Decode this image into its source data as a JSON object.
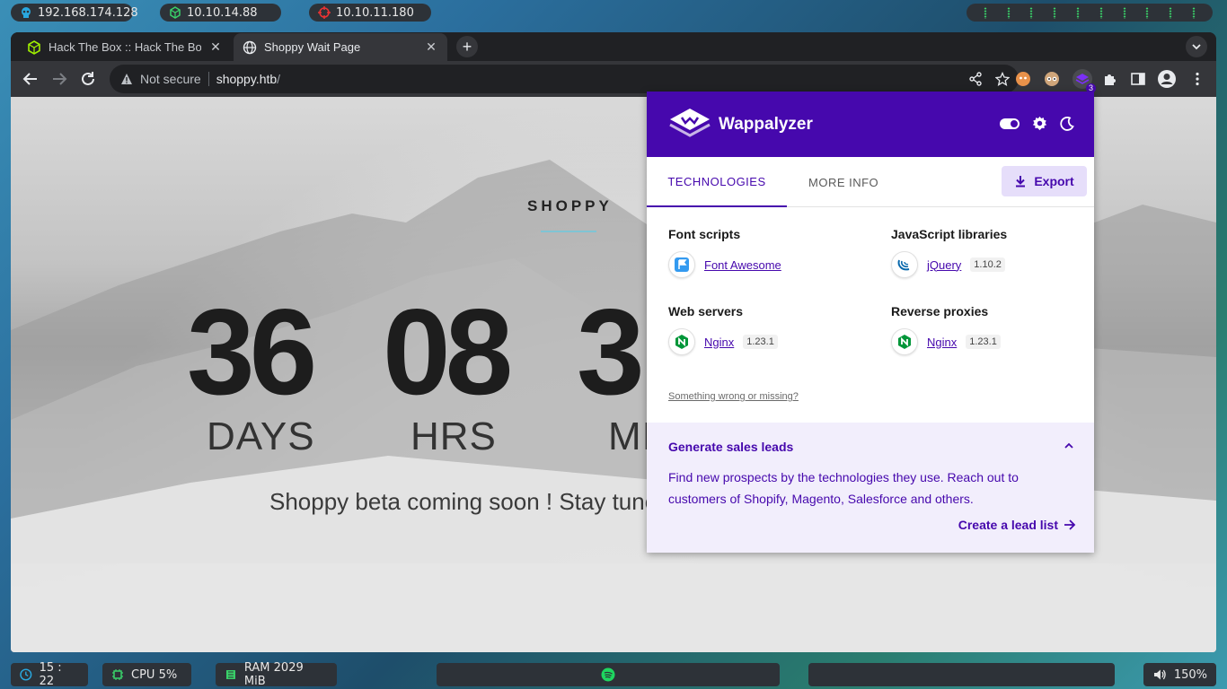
{
  "topbar": {
    "ip_local": "192.168.174.128",
    "ip_vpn": "10.10.14.88",
    "ip_target": "10.10.11.180"
  },
  "browser": {
    "tabs": [
      {
        "title": "Hack The Box :: Hack The Box",
        "active": false
      },
      {
        "title": "Shoppy Wait Page",
        "active": true
      }
    ],
    "close_glyph": "✕",
    "new_tab_glyph": "+",
    "omnibox": {
      "security_label": "Not secure",
      "url_host": "shoppy.htb",
      "url_path": "/"
    },
    "wappalyzer_badge": "3"
  },
  "page": {
    "brand": "SHOPPY",
    "countdown": [
      {
        "value": "36",
        "unit": "DAYS"
      },
      {
        "value": "08",
        "unit": "HRS"
      },
      {
        "value": "3",
        "unit": "MI"
      }
    ],
    "tagline": "Shoppy beta coming soon ! Stay tuned"
  },
  "wappalyzer": {
    "brand": "Wappalyzer",
    "tabs": [
      "TECHNOLOGIES",
      "MORE INFO"
    ],
    "export_label": "Export",
    "categories": [
      {
        "name": "Font scripts",
        "tech": {
          "name": "Font Awesome",
          "version": "",
          "icon": "font-awesome-icon"
        }
      },
      {
        "name": "JavaScript libraries",
        "tech": {
          "name": "jQuery",
          "version": "1.10.2",
          "icon": "jquery-icon"
        }
      },
      {
        "name": "Web servers",
        "tech": {
          "name": "Nginx",
          "version": "1.23.1",
          "icon": "nginx-icon"
        }
      },
      {
        "name": "Reverse proxies",
        "tech": {
          "name": "Nginx",
          "version": "1.23.1",
          "icon": "nginx-icon"
        }
      }
    ],
    "wrong_link": "Something wrong or missing?",
    "leads": {
      "title": "Generate sales leads",
      "text": "Find new prospects by the technologies they use. Reach out to customers of Shopify, Magento, Salesforce and others.",
      "link": "Create a lead list"
    },
    "accent": "#4608ad"
  },
  "bottombar": {
    "clock": "15 : 22",
    "cpu": "CPU 5%",
    "ram": "RAM 2029 MiB",
    "volume": "150%"
  }
}
